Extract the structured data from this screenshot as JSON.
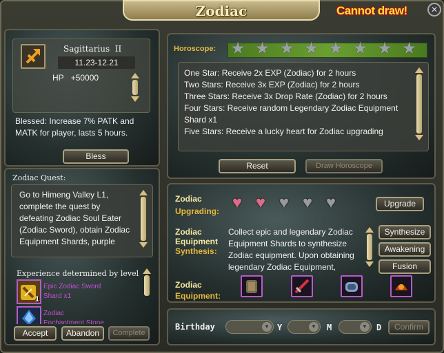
{
  "window": {
    "title": "Zodiac",
    "warning": "Cannot draw!",
    "close_glyph": "✕"
  },
  "sign": {
    "name": "Sagittarius",
    "rank": "II",
    "dates": "11.23-12.21",
    "hp_label": "HP",
    "hp_value": "+50000",
    "icon": "sagittarius-arrow-icon"
  },
  "blessed": {
    "text": "Blessed: Increase 7% PATK and MATK for player, lasts 5 hours.",
    "button": "Bless"
  },
  "quest": {
    "title": "Zodiac Quest:",
    "text": "Go to Himeng Valley L1, complete the quest by defeating Zodiac Soul Eater (Zodiac Sword), obtain Zodiac Equipment Shards, purple",
    "exp_label": "Experience determined by level",
    "rewards": [
      {
        "name_line1": "Epic Zodiac Sword",
        "name_line2": "Shard x1",
        "count": "1"
      },
      {
        "name_line1": "Zodiac",
        "name_line2": "Enchantment Stone"
      }
    ],
    "buttons": {
      "accept": "Accept",
      "abandon": "Abandon",
      "complete": "Complete"
    }
  },
  "horoscope": {
    "label": "Horoscope:",
    "stars_total": 8,
    "stars_filled": 0,
    "lines": [
      "One Star: Receive 2x EXP (Zodiac) for 2 hours",
      "Two Stars: Receive 3x EXP (Zodiac) for 2 hours",
      "Three Stars: Receive 3x Drop Rate (Zodiac) for 2 hours",
      "Four Stars: Receive random Legendary Zodiac Equipment Shard x1",
      "Five Stars: Receive a lucky heart for Zodiac upgrading"
    ],
    "buttons": {
      "reset": "Reset",
      "draw": "Draw Horoscope"
    }
  },
  "upgrading": {
    "label_a": "Zodiac",
    "label_b": "Upgrading:",
    "hearts_total": 5,
    "hearts_filled": 2,
    "button": "Upgrade"
  },
  "synthesis": {
    "label_a": "Zodiac",
    "label_b": "Equipment",
    "label_c": "Synthesis:",
    "text": "Collect epic and legendary Zodiac Equipment Shards to synthesize Zodiac equipment. Upon obtaining legendary Zodiac Equipment,",
    "buttons": {
      "synthesize": "Synthesize",
      "awakening": "Awakening",
      "fusion": "Fusion"
    }
  },
  "equipment": {
    "label_a": "Zodiac",
    "label_b": "Equipment:",
    "items": [
      "armor-icon",
      "sword-icon",
      "bracer-icon",
      "helmet-icon"
    ]
  },
  "birthday": {
    "label": "Birthday",
    "y": "Y",
    "m": "M",
    "d": "D",
    "confirm": "Confirm"
  },
  "colors": {
    "gold": "#e6b83a",
    "purple": "#b55cc8",
    "heart_filled": "#e06a8a",
    "star": "#9aa0a4"
  }
}
